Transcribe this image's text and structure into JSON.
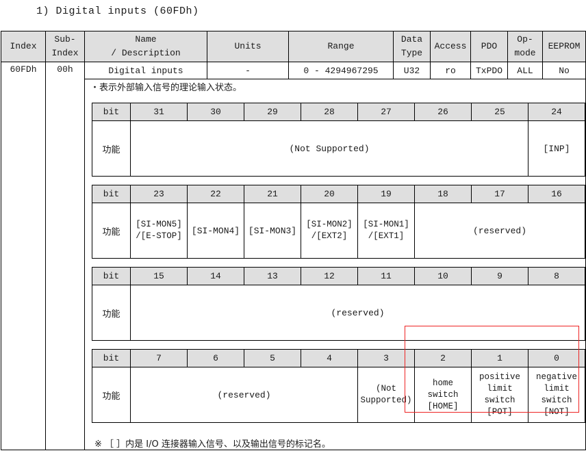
{
  "heading": "1) Digital inputs (60FDh)",
  "object_table": {
    "headers": [
      {
        "l1": "Index",
        "l2": ""
      },
      {
        "l1": "Sub-",
        "l2": "Index"
      },
      {
        "l1": "Name",
        "l2": "/ Description"
      },
      {
        "l1": "Units",
        "l2": ""
      },
      {
        "l1": "Range",
        "l2": ""
      },
      {
        "l1": "Data",
        "l2": "Type"
      },
      {
        "l1": "Access",
        "l2": ""
      },
      {
        "l1": "PDO",
        "l2": ""
      },
      {
        "l1": "Op-",
        "l2": "mode"
      },
      {
        "l1": "EEPROM",
        "l2": ""
      }
    ],
    "row": {
      "index": "60FDh",
      "sub_index": "00h",
      "name": "Digital inputs",
      "units": "-",
      "range": "0 - 4294967295",
      "data_type": "U32",
      "access": "ro",
      "pdo": "TxPDO",
      "op_mode": "ALL",
      "eeprom": "No"
    },
    "description": "・表示外部输入信号的理论输入状态。",
    "footnote": "※ ［ ］内是 I/O 连接器输入信号、以及输出信号的标记名。"
  },
  "bit_label": "bit",
  "function_label": "功能",
  "bit_tables": [
    {
      "bits": [
        "31",
        "30",
        "29",
        "28",
        "27",
        "26",
        "25",
        "24"
      ],
      "cells": [
        {
          "text": "(Not Supported)",
          "span": 7
        },
        {
          "text": "[INP]",
          "span": 1
        }
      ]
    },
    {
      "bits": [
        "23",
        "22",
        "21",
        "20",
        "19",
        "18",
        "17",
        "16"
      ],
      "cells": [
        {
          "text": "[SI-MON5]\n/[E-STOP]",
          "span": 1
        },
        {
          "text": "[SI-MON4]",
          "span": 1
        },
        {
          "text": "[SI-MON3]",
          "span": 1
        },
        {
          "text": "[SI-MON2]\n/[EXT2]",
          "span": 1
        },
        {
          "text": "[SI-MON1]\n/[EXT1]",
          "span": 1
        },
        {
          "text": "(reserved)",
          "span": 3
        }
      ]
    },
    {
      "bits": [
        "15",
        "14",
        "13",
        "12",
        "11",
        "10",
        "9",
        "8"
      ],
      "cells": [
        {
          "text": "(reserved)",
          "span": 8
        }
      ]
    },
    {
      "bits": [
        "7",
        "6",
        "5",
        "4",
        "3",
        "2",
        "1",
        "0"
      ],
      "cells": [
        {
          "text": "(reserved)",
          "span": 4
        },
        {
          "text": "(Not\nSupported)",
          "span": 1
        },
        {
          "text": "home\nswitch\n[HOME]",
          "span": 1
        },
        {
          "text": "positive\nlimit\nswitch\n[POT]",
          "span": 1
        },
        {
          "text": "negative\nlimit\nswitch\n[NOT]",
          "span": 1
        }
      ]
    }
  ],
  "highlight": {
    "color": "#ee2222",
    "covers_bits": [
      "2",
      "1",
      "0"
    ]
  }
}
